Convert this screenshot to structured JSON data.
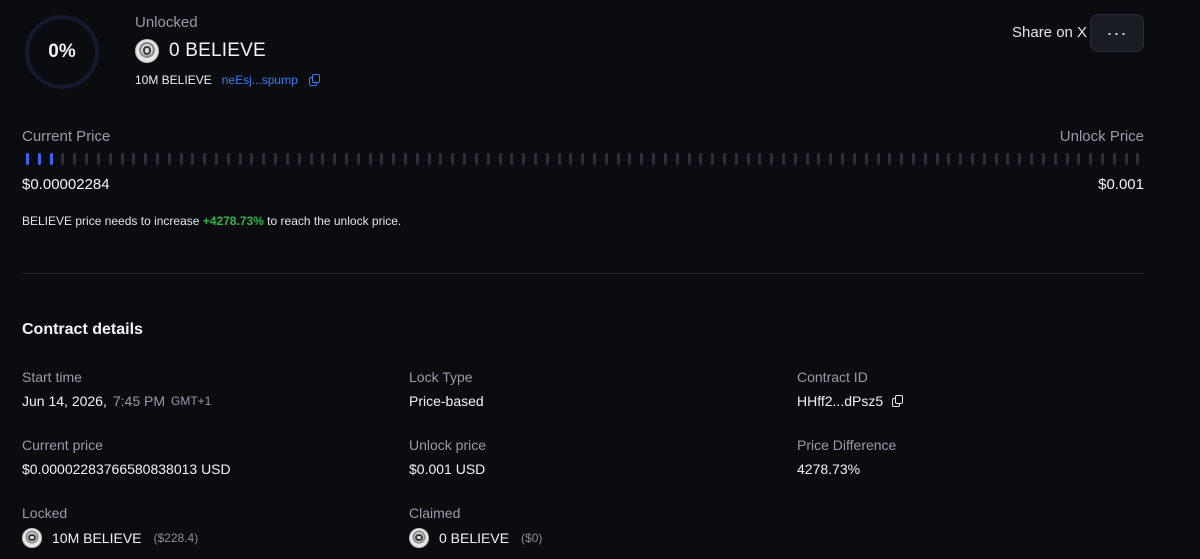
{
  "header": {
    "progress_text": "0%",
    "progress_fraction": 0,
    "unlocked_label": "Unlocked",
    "unlocked_amount": "0 BELIEVE",
    "total_amount": "10M BELIEVE",
    "token_address_short": "neEsj...spump",
    "share_label": "Share on X",
    "more_label": "···"
  },
  "price": {
    "current_label": "Current Price",
    "unlock_label": "Unlock Price",
    "current_value": "$0.00002284",
    "unlock_value": "$0.001",
    "progress_ticks_active": 3,
    "progress_ticks_total": 95,
    "notice_prefix": "BELIEVE price needs to increase ",
    "notice_pct": "+4278.73%",
    "notice_suffix": " to reach the unlock price."
  },
  "contract": {
    "title": "Contract details",
    "start_time_label": "Start time",
    "start_date": "Jun 14, 2026,",
    "start_time": "7:45 PM",
    "start_tz": "GMT+1",
    "lock_type_label": "Lock Type",
    "lock_type_value": "Price-based",
    "contract_id_label": "Contract ID",
    "contract_id_value": "HHff2...dPsz5",
    "current_price_label": "Current price",
    "current_price_value": "$0.0000228376658083801​3 USD",
    "unlock_price_label": "Unlock price",
    "unlock_price_value": "$0.001 USD",
    "price_diff_label": "Price Difference",
    "price_diff_value": "4278.73%",
    "locked_label": "Locked",
    "locked_value": "10M BELIEVE",
    "locked_usd": "($228.4)",
    "claimed_label": "Claimed",
    "claimed_value": "0 BELIEVE",
    "claimed_usd": "($0)"
  },
  "colors": {
    "accent_blue": "#3d63f5",
    "link_blue": "#3d7bf0",
    "positive_green": "#2fb34a",
    "background": "#0b0c10"
  },
  "icons": {
    "token": "believe-coin-icon",
    "copy": "copy-icon",
    "more": "more-horizontal-icon"
  }
}
